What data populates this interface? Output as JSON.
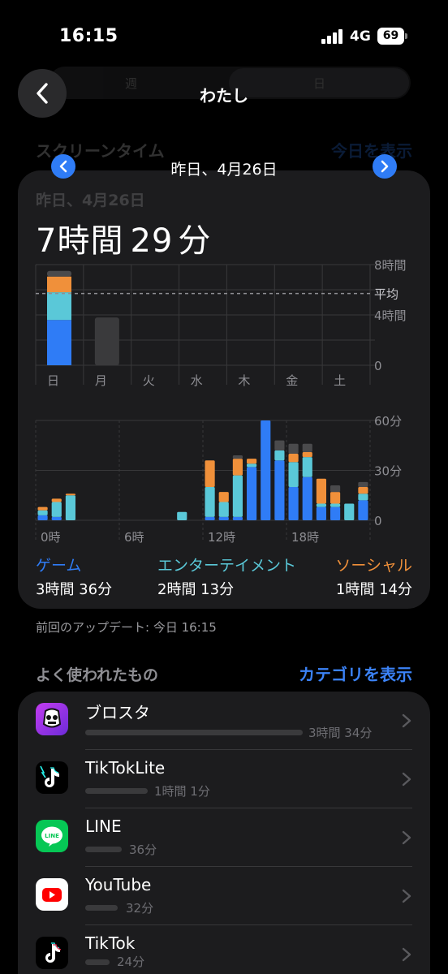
{
  "status_bar": {
    "time": "16:15",
    "network": "4G",
    "battery": "69"
  },
  "background_header": {
    "segment_left": "週",
    "segment_right": "日",
    "title": "スクリーンタイム",
    "action": "今日を表示"
  },
  "nav": {
    "back_icon": "chevron-left-icon",
    "title": "わたし"
  },
  "date_nav": {
    "label": "昨日、4月26日",
    "prev_icon": "chevron-left-icon",
    "next_icon": "chevron-right-icon"
  },
  "summary": {
    "ghost_date": "昨日、4月26日",
    "total_prefix_num": "7",
    "total_prefix_unit": "時間",
    "total_suffix_num": "29",
    "total_suffix_unit": "分"
  },
  "colors": {
    "game": "#2f7cf6",
    "entertainment": "#5ac8d8",
    "social": "#f0903a",
    "other": "#4a4a4c",
    "accent": "#2f7cf6"
  },
  "chart_data": [
    {
      "type": "bar",
      "title": "",
      "categories": [
        "日",
        "月",
        "火",
        "水",
        "木",
        "金",
        "土"
      ],
      "y_tick_labels": [
        "8時間",
        "4時間",
        "0"
      ],
      "average_label": "平均",
      "ylim_hours": [
        0,
        8
      ],
      "average_hours": 5.7,
      "series": [
        {
          "name": "ゲーム",
          "values": [
            3.6,
            0,
            0,
            0,
            0,
            0,
            0
          ]
        },
        {
          "name": "エンターテイメント",
          "values": [
            2.2,
            0,
            0,
            0,
            0,
            0,
            0
          ]
        },
        {
          "name": "ソーシャル",
          "values": [
            1.25,
            0,
            0,
            0,
            0,
            0,
            0
          ]
        },
        {
          "values": [
            0.45,
            3.8,
            0,
            0,
            0,
            0,
            0
          ]
        }
      ]
    },
    {
      "type": "bar",
      "title": "",
      "x_tick_labels": [
        "0時",
        "6時",
        "12時",
        "18時"
      ],
      "y_tick_labels": [
        "60分",
        "30分",
        "0"
      ],
      "ylim_minutes": [
        0,
        60
      ],
      "hours": [
        0,
        1,
        2,
        3,
        4,
        5,
        6,
        7,
        8,
        9,
        10,
        11,
        12,
        13,
        14,
        15,
        16,
        17,
        18,
        19,
        20,
        21,
        22,
        23
      ],
      "series": [
        {
          "name": "ゲーム",
          "values": [
            3,
            2,
            0,
            0,
            0,
            0,
            0,
            0,
            0,
            0,
            0,
            0,
            2,
            2,
            2,
            32,
            60,
            36,
            20,
            26,
            8,
            8,
            0,
            12
          ]
        },
        {
          "name": "エンターテイメント",
          "values": [
            3,
            9,
            15,
            0,
            0,
            0,
            0,
            0,
            0,
            0,
            5,
            0,
            18,
            9,
            25,
            2,
            0,
            6,
            15,
            12,
            2,
            2,
            10,
            4
          ]
        },
        {
          "name": "ソーシャル",
          "values": [
            2,
            2,
            1,
            0,
            0,
            0,
            0,
            0,
            0,
            0,
            0,
            0,
            16,
            6,
            10,
            3,
            0,
            0,
            5,
            3,
            15,
            7,
            0,
            4
          ]
        },
        {
          "values": [
            0,
            0,
            0,
            0,
            0,
            0,
            0,
            0,
            0,
            0,
            0,
            0,
            0,
            0,
            2,
            0,
            0,
            6,
            6,
            5,
            0,
            4,
            0,
            3
          ]
        }
      ]
    }
  ],
  "legend": [
    {
      "label": "ゲーム",
      "value": "3時間 36分",
      "color": "#2f7cf6"
    },
    {
      "label": "エンターテイメント",
      "value": "2時間 13分",
      "color": "#5ac8d8"
    },
    {
      "label": "ソーシャル",
      "value": "1時間 14分",
      "color": "#f0903a"
    }
  ],
  "last_updated": "前回のアップデート: 今日 16:15",
  "most_used": {
    "title": "よく使われたもの",
    "action": "カテゴリを表示",
    "apps": [
      {
        "name": "ブロスタ",
        "duration": "3時間 34分",
        "icon": "brawl-stars-icon",
        "minutes": 214
      },
      {
        "name": "TikTokLite",
        "duration": "1時間 1分",
        "icon": "tiktok-lite-icon",
        "minutes": 61
      },
      {
        "name": "LINE",
        "duration": "36分",
        "icon": "line-icon",
        "minutes": 36
      },
      {
        "name": "YouTube",
        "duration": "32分",
        "icon": "youtube-icon",
        "minutes": 32
      },
      {
        "name": "TikTok",
        "duration": "24分",
        "icon": "tiktok-icon",
        "minutes": 24
      }
    ]
  }
}
